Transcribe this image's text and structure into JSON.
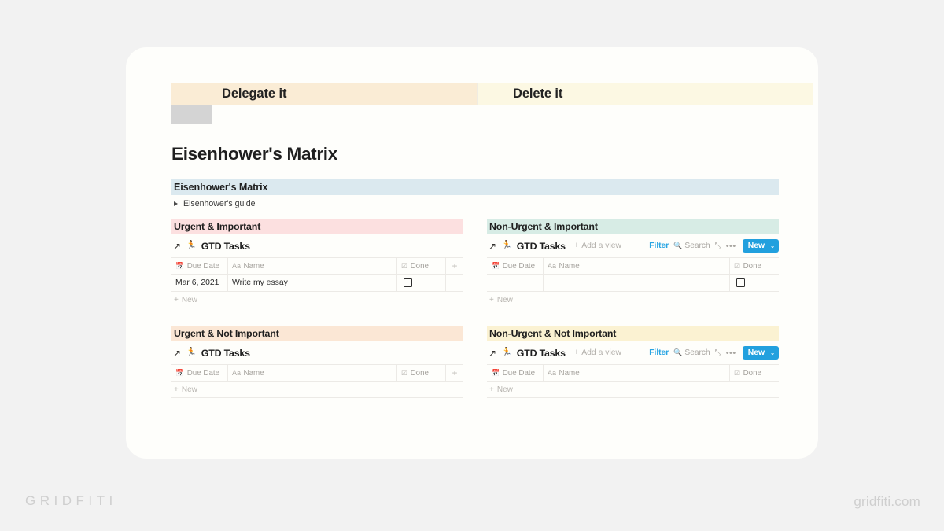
{
  "watermarks": {
    "left": "GRIDFITI",
    "right": "gridfiti.com"
  },
  "banner": {
    "placeholder_name": "image-placeholder",
    "delegate_label": "Delegate it",
    "delete_label": "Delete it",
    "delegate_bg": "#faecd5",
    "delete_bg": "#fcf8e3"
  },
  "page_title": "Eisenhower's Matrix",
  "section": {
    "bar_label": "Eisenhower's Matrix",
    "bar_bg": "#dbe9ef",
    "toggle_label": "Eisenhower's guide",
    "toggle_caret": "collapsed"
  },
  "toolbar_common": {
    "arrow_icon": "↗",
    "emoji_icon": "🏃",
    "db_title": "GTD Tasks",
    "add_view_label": "Add a view",
    "filter_label": "Filter",
    "search_label": "Search",
    "expand_icon": "⤢",
    "more_icon": "•••",
    "new_label": "New",
    "new_chevron": "⌄",
    "accent_blue": "#22a0de"
  },
  "table_columns": {
    "due_date": "Due Date",
    "name": "Name",
    "done": "Done",
    "add_column": "+",
    "date_icon": "📅",
    "name_icon": "Aa",
    "done_icon": "☑",
    "new_row_label": "New",
    "new_row_plus": "+"
  },
  "quadrants": [
    {
      "title": "Urgent & Important",
      "header_bg": "#fce0e0",
      "has_full_toolbar": false,
      "has_add_column": true,
      "rows": [
        {
          "due_date": "Mar 6, 2021",
          "name": "Write my essay",
          "done": false
        }
      ]
    },
    {
      "title": "Non-Urgent & Important",
      "header_bg": "#d7ece5",
      "has_full_toolbar": true,
      "has_add_column": false,
      "rows": [
        {
          "due_date": "",
          "name": "",
          "done": false
        }
      ]
    },
    {
      "title": "Urgent & Not Important",
      "header_bg": "#fbe7d5",
      "has_full_toolbar": false,
      "has_add_column": true,
      "rows": []
    },
    {
      "title": "Non-Urgent & Not Important",
      "header_bg": "#fbf2d2",
      "has_full_toolbar": true,
      "has_add_column": false,
      "rows": []
    }
  ]
}
